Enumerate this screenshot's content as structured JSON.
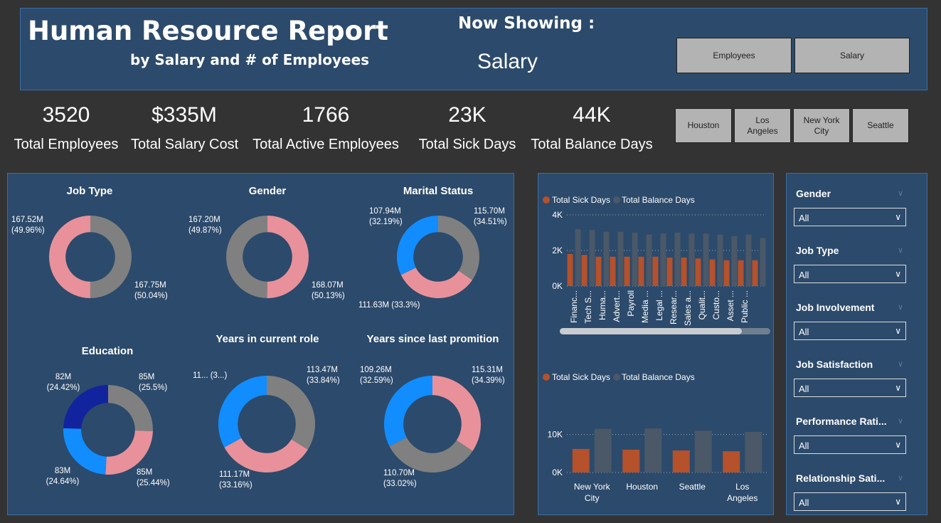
{
  "header": {
    "title": "Human Resource Report",
    "subtitle": "by Salary and # of Employees",
    "now_showing_label": "Now Showing :",
    "now_showing_value": "Salary",
    "toggle_buttons": [
      "Employees",
      "Salary"
    ]
  },
  "kpis": [
    {
      "value": "3520",
      "label": "Total Employees"
    },
    {
      "value": "$335M",
      "label": "Total Salary Cost"
    },
    {
      "value": "1766",
      "label": "Total Active Employees"
    },
    {
      "value": "23K",
      "label": "Total Sick Days"
    },
    {
      "value": "44K",
      "label": "Total Balance Days"
    }
  ],
  "city_buttons": [
    "Houston",
    "Los Angeles",
    "New York City",
    "Seattle"
  ],
  "donuts": [
    {
      "title": "Job Type",
      "slices": [
        {
          "label": "167.75M (50.04%)",
          "value": 167.75,
          "color": "#808080"
        },
        {
          "label": "167.52M (49.96%)",
          "value": 167.52,
          "color": "#e8919a"
        }
      ]
    },
    {
      "title": "Gender",
      "slices": [
        {
          "label": "168.07M (50.13%)",
          "value": 168.07,
          "color": "#e8919a"
        },
        {
          "label": "167.20M (49.87%)",
          "value": 167.2,
          "color": "#808080"
        }
      ]
    },
    {
      "title": "Marital Status",
      "slices": [
        {
          "label": "115.70M (34.51%)",
          "value": 115.7,
          "color": "#808080"
        },
        {
          "label": "111.63M (33.3%)",
          "value": 111.63,
          "color": "#e8919a"
        },
        {
          "label": "107.94M (32.19%)",
          "value": 107.94,
          "color": "#118dff"
        }
      ]
    },
    {
      "title": "Education",
      "slices": [
        {
          "label": "85M (25.5%)",
          "value": 85.5,
          "color": "#808080"
        },
        {
          "label": "85M (25.44%)",
          "value": 85.3,
          "color": "#e8919a"
        },
        {
          "label": "83M (24.64%)",
          "value": 82.6,
          "color": "#118dff"
        },
        {
          "label": "82M (24.42%)",
          "value": 81.9,
          "color": "#12239e"
        }
      ]
    },
    {
      "title": "Years in current role",
      "slices": [
        {
          "label": "113.47M (33.84%)",
          "value": 113.47,
          "color": "#808080"
        },
        {
          "label": "111.17M (33.16%)",
          "value": 111.17,
          "color": "#e8919a"
        },
        {
          "label": "11... (3...)",
          "value": 110.6,
          "color": "#118dff"
        }
      ]
    },
    {
      "title": "Years since last promition",
      "slices": [
        {
          "label": "115.31M (34.39%)",
          "value": 115.31,
          "color": "#e8919a"
        },
        {
          "label": "110.70M (33.02%)",
          "value": 110.7,
          "color": "#808080"
        },
        {
          "label": "109.26M (32.59%)",
          "value": 109.26,
          "color": "#118dff"
        }
      ]
    }
  ],
  "chart_data": [
    {
      "type": "bar",
      "series": [
        {
          "name": "Total Sick Days",
          "color": "#b5512b",
          "values": [
            1800,
            1750,
            1650,
            1650,
            1650,
            1650,
            1650,
            1600,
            1600,
            1550,
            1500,
            1450,
            1450,
            1450
          ]
        },
        {
          "name": "Total Balance Days",
          "color": "#4a5868",
          "values": [
            3200,
            3150,
            3050,
            3050,
            3000,
            2900,
            2950,
            3000,
            2950,
            2950,
            2900,
            2800,
            2900,
            2700
          ]
        }
      ],
      "categories": [
        "Financ...",
        "Tech S...",
        "Huma...",
        "Advert...",
        "Payroll",
        "Media ...",
        "Legal ...",
        "Resear...",
        "Sales a...",
        "Qualit...",
        "Custo...",
        "Asset ...",
        "Public ...",
        ""
      ],
      "yticks": [
        "4K",
        "2K",
        "0K"
      ],
      "ylim": [
        0,
        4000
      ]
    },
    {
      "type": "bar",
      "series": [
        {
          "name": "Total Sick Days",
          "color": "#b5512b",
          "values": [
            6200,
            6000,
            5800,
            5600
          ]
        },
        {
          "name": "Total Balance Days",
          "color": "#4a5868",
          "values": [
            11500,
            11600,
            11000,
            10700
          ]
        }
      ],
      "categories": [
        "New York City",
        "Houston",
        "Seattle",
        "Los Angeles"
      ],
      "yticks": [
        "10K",
        "0K"
      ],
      "ylim": [
        0,
        15000
      ]
    }
  ],
  "slicers": [
    {
      "title": "Gender",
      "value": "All"
    },
    {
      "title": "Job Type",
      "value": "All"
    },
    {
      "title": "Job Involvement",
      "value": "All"
    },
    {
      "title": "Job Satisfaction",
      "value": "All"
    },
    {
      "title": "Performance Rati...",
      "value": "All"
    },
    {
      "title": "Relationship Sati...",
      "value": "All"
    }
  ]
}
